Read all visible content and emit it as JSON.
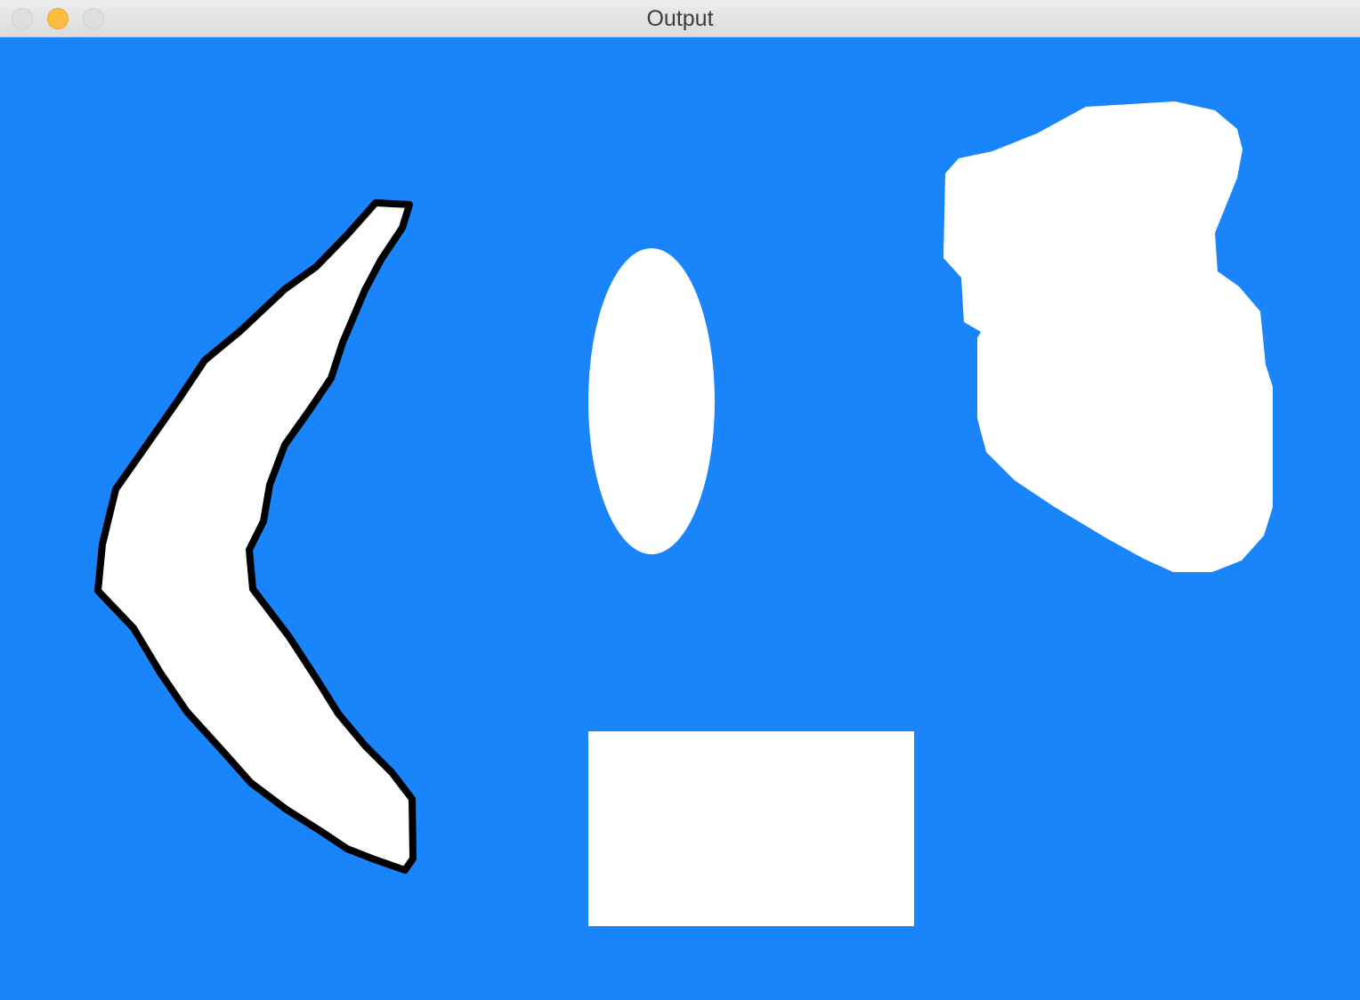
{
  "window": {
    "title": "Output",
    "controls": [
      "close",
      "minimize",
      "zoom"
    ]
  },
  "canvas": {
    "background_color": "#1a84fa",
    "shape_fill_color": "#ffffff",
    "outline_color": "#000000",
    "shapes": [
      "boomerang-outlined",
      "ellipse",
      "blob",
      "rectangle"
    ]
  }
}
